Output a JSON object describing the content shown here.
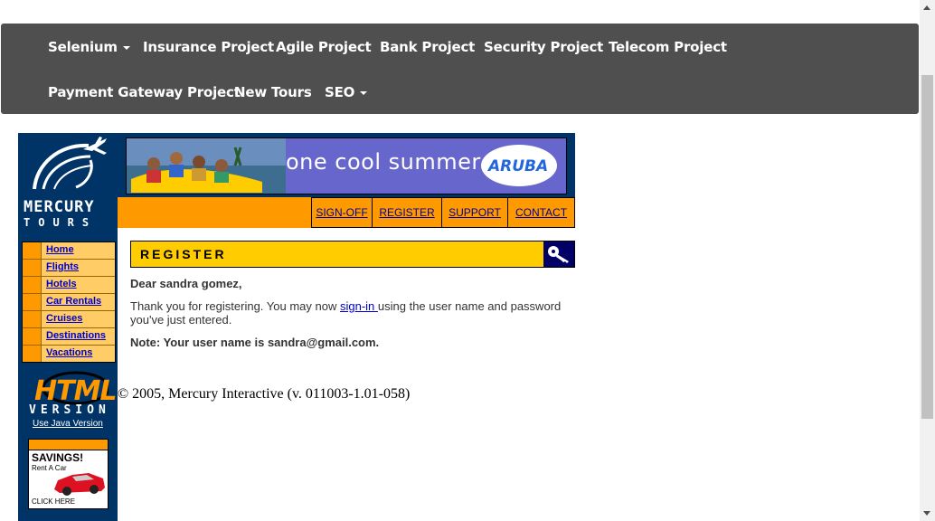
{
  "navbar": {
    "row1": [
      {
        "label": "Selenium",
        "dropdown": true
      },
      {
        "label": "Insurance Project",
        "dropdown": false
      },
      {
        "label": "Agile Project",
        "dropdown": false
      },
      {
        "label": "Bank Project",
        "dropdown": false
      },
      {
        "label": "Security Project",
        "dropdown": false
      },
      {
        "label": "Telecom Project",
        "dropdown": false
      }
    ],
    "row2": [
      {
        "label": "Payment Gateway Project",
        "dropdown": false
      },
      {
        "label": "New Tours",
        "dropdown": false
      },
      {
        "label": "SEO",
        "dropdown": true
      }
    ]
  },
  "logo": {
    "line1": "MERCURY",
    "line2": "TOURS"
  },
  "sidemenu": [
    "Home",
    "Flights",
    "Hotels",
    "Car Rentals",
    "Cruises",
    "Destinations",
    "Vacations"
  ],
  "html_version": {
    "word1": "HTML",
    "word2": "VERSION",
    "java_link": "Use Java Version"
  },
  "savings_ad": {
    "title": "SAVINGS!",
    "subtitle": "Rent A Car",
    "cta": "CLICK HERE"
  },
  "banner": {
    "text": "one cool summer",
    "brand": "ARUBA"
  },
  "toplinks": [
    "SIGN-OFF",
    "REGISTER",
    "SUPPORT",
    "CONTACT"
  ],
  "register": {
    "title": "REGISTER",
    "greeting": "Dear sandra gomez,",
    "thanks_before": "Thank you for registering. You may now ",
    "signin_link": "sign-in ",
    "thanks_after": "using the user name and password you've just entered.",
    "note": "Note: Your user name is sandra@gmail.com."
  },
  "footer": "© 2005, Mercury Interactive (v. 011003-1.01-058)",
  "colors": {
    "navbar": "#4f4f4f",
    "sidebar": "#003366",
    "orange": "#ff9900",
    "yellow": "#ffcc00"
  }
}
